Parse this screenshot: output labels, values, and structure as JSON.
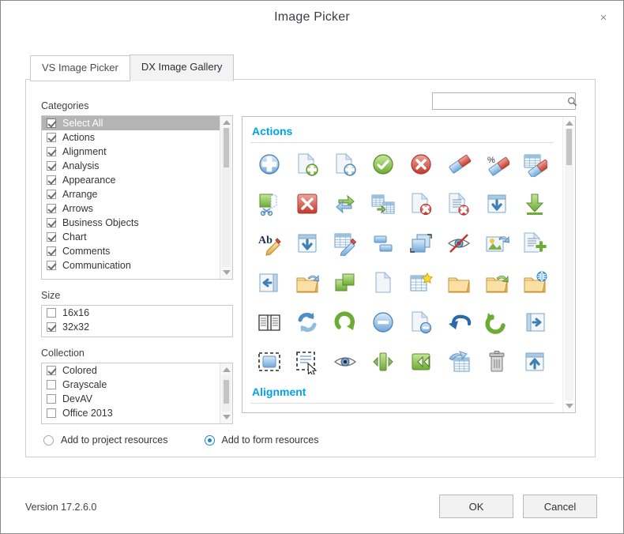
{
  "window": {
    "title": "Image Picker",
    "close_label": "×"
  },
  "tabs": [
    {
      "label": "VS Image Picker",
      "active": false
    },
    {
      "label": "DX Image Gallery",
      "active": true
    }
  ],
  "left_panel": {
    "categories": {
      "label": "Categories",
      "items": [
        {
          "label": "Select All",
          "checked": true,
          "selected": true
        },
        {
          "label": "Actions",
          "checked": true,
          "selected": false
        },
        {
          "label": "Alignment",
          "checked": true,
          "selected": false
        },
        {
          "label": "Analysis",
          "checked": true,
          "selected": false
        },
        {
          "label": "Appearance",
          "checked": true,
          "selected": false
        },
        {
          "label": "Arrange",
          "checked": true,
          "selected": false
        },
        {
          "label": "Arrows",
          "checked": true,
          "selected": false
        },
        {
          "label": "Business Objects",
          "checked": true,
          "selected": false
        },
        {
          "label": "Chart",
          "checked": true,
          "selected": false
        },
        {
          "label": "Comments",
          "checked": true,
          "selected": false
        },
        {
          "label": "Communication",
          "checked": true,
          "selected": false
        }
      ]
    },
    "size": {
      "label": "Size",
      "items": [
        {
          "label": "16x16",
          "checked": false
        },
        {
          "label": "32x32",
          "checked": true
        }
      ]
    },
    "collection": {
      "label": "Collection",
      "items": [
        {
          "label": "Colored",
          "checked": true
        },
        {
          "label": "Grayscale",
          "checked": false
        },
        {
          "label": "DevAV",
          "checked": false
        },
        {
          "label": "Office 2013",
          "checked": false
        }
      ]
    }
  },
  "search": {
    "value": "",
    "placeholder": ""
  },
  "gallery": {
    "groups": [
      {
        "header": "Actions",
        "rows": [
          [
            "add-circle-blue",
            "new-document-add",
            "document-add-blue",
            "apply-check-green",
            "cancel-cross-red",
            "eraser",
            "clear-format-percent",
            "clear-table-formatting"
          ],
          [
            "cut-green",
            "close-red-square",
            "convert-arrows",
            "convert-to-table",
            "delete-document",
            "delete-text-document",
            "download-window",
            "download-arrow-green"
          ],
          [
            "edit-text-ab",
            "expand-window-down",
            "edit-table-pencil",
            "group-shapes",
            "bring-to-front",
            "hide-eye-crossed",
            "export-image",
            "add-list-item"
          ],
          [
            "previous-page-book",
            "open-folder-export",
            "merge-shapes-green",
            "new-blank-document",
            "new-table-star",
            "open-folder",
            "open-folder-back",
            "open-folder-web"
          ],
          [
            "open-book",
            "refresh-sync-blue",
            "refresh-circle-green",
            "remove-minus-circle",
            "remove-document",
            "undo-arrow",
            "reset-arrow-green",
            "next-page-book"
          ],
          [
            "select-all-region",
            "select-content",
            "show-eye",
            "collapse-horizontal",
            "expand-horizontal",
            "swap-table",
            "trash-bin",
            "upload-window"
          ]
        ]
      },
      {
        "header": "Alignment",
        "rows": []
      }
    ]
  },
  "resource_options": {
    "items": [
      {
        "label": "Add to project resources",
        "selected": false
      },
      {
        "label": "Add to form resources",
        "selected": true
      }
    ]
  },
  "footer": {
    "version": "Version 17.2.6.0",
    "ok_label": "OK",
    "cancel_label": "Cancel"
  },
  "colors": {
    "accent_heading": "#00a3e6",
    "radio_accent": "#1a87c9",
    "selection": "#b4b4b4"
  }
}
